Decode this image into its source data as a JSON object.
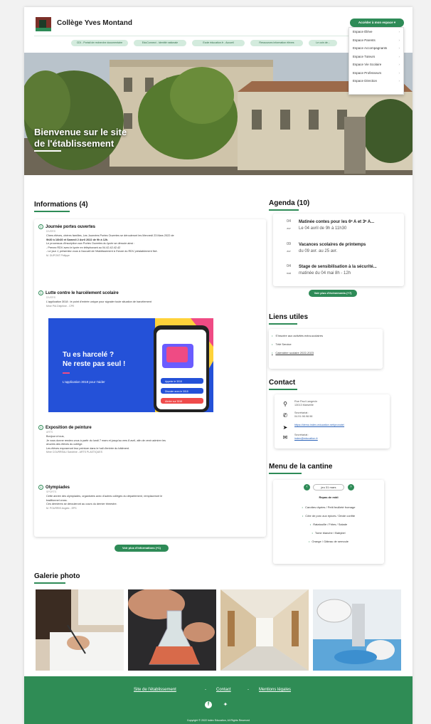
{
  "header": {
    "school_name": "Collège Yves Montand",
    "access_button": "Accéder à mon espace ▾",
    "dropdown": [
      "Espace Élève",
      "Espace Parents",
      "Espace Accompagnants",
      "Espace Tuteurs",
      "Espace Vie Scolaire",
      "Espace Professeurs",
      "Espace Direction"
    ],
    "quick_links": [
      "CDI - Portail de recherche documentaire",
      "EduConnect - Identité nationale",
      "Ecole éducation.fr - Accueil",
      "Ressources information élèves",
      "Le coin de..."
    ]
  },
  "hero": {
    "title_line1": "Bienvenue sur le site",
    "title_line2": "de l'établissement"
  },
  "info": {
    "heading": "Informations (4)",
    "button": "Voir plus d'informations (+1)",
    "items": [
      {
        "title": "Journée portes ouvertes",
        "category": "DIVERS",
        "lines": [
          "Chers élèves, chères familles, Les Journées Portes Ouvertes se dérouleront les Mercredi 23 Mars 2022 de",
          "9h30 à 16h30 et Samedi 2 Avril 2022 de 9h à 12h.",
          "Le processus d'inscription aux Portes Ouvertes du lycée se déroule ainsi :",
          "- Prenez RDV avec le lycée en téléphonant au 04.42.42.42.42",
          "- Le jour J, présentez vous à l'accueil de l'établissement à l'heure du RDV préalablement fixé."
        ],
        "signature": "M. DUPONT Philippe"
      },
      {
        "title": "Lutte contre le harcèlement scolaire",
        "category": "DIVERS",
        "lines": [
          "L'application 3018 : le point d'entrée unique pour signaler toute situation de harcèlement"
        ],
        "signature": "Mme PIA Delphine - CPE",
        "image": {
          "headline1": "Tu es harcelé ?",
          "headline2": "Ne reste pas seul !",
          "caption": "L'application 3018 pour t'aider",
          "phone_btn1": "Appeler le 3018",
          "phone_btn2": "Discuter avec le 3018",
          "phone_btn3": "Alerter sur 3018"
        }
      },
      {
        "title": "Exposition de peinture",
        "category": "ARTS",
        "lines": [
          "Bonjour à tous,",
          "Je vous donne rendez-vous à partir du lundi 7 mars et jusqu'au vers 8 avril, afin de venir admirer les",
          "œuvres des élèves du collège.",
          "Les élèves exposeront leur peinture dans le hall d'entrée du bâtiment."
        ],
        "signature": "Mme COURREAU Sandrine - ARTS PLASTIQUES"
      },
      {
        "title": "Olympiades",
        "category": "SPORTS",
        "lines": [
          "Cette année des olympiades, organisées avec d'autres collèges du département, remplaceront le",
          "traditionnel cross.",
          "Ces dernières se dérouleront au cours du dernier trimestre."
        ],
        "signature": "M. POURRIS Angelo - EPS"
      }
    ]
  },
  "agenda": {
    "heading": "Agenda (10)",
    "button": "Voir plus d'événements (+7)",
    "events": [
      {
        "day": "04",
        "month": "avr",
        "title": "Matinée contes pour les 6ᵉ A et 3ᵉ A...",
        "detail": "Le 04 avril de 9h à 11h30"
      },
      {
        "day": "09",
        "month": "avr",
        "title": "Vacances scolaires de printemps",
        "detail": "du 09 avr. au 25 avr."
      },
      {
        "day": "04",
        "month": "mai",
        "title": "Stage de sensibilisation à la sécurité...",
        "detail": "matinée du 04 mai 8h - 12h"
      }
    ]
  },
  "liens": {
    "heading": "Liens utiles",
    "items": [
      "S'inscrire aux activités extra-scolaires",
      "Télé Service",
      "Calendrier scolaire 2022-2023"
    ]
  },
  "contact": {
    "heading": "Contact",
    "address1": "Rue Paul Langevin",
    "address2": "13013 Marseille",
    "phone_label": "Secrétariat :",
    "phone": "04.91.98.98.98",
    "website": "https://demo.index-education.net/pronote/",
    "email_label": "Secrétariat :",
    "email": "index@education.fr"
  },
  "cantine": {
    "heading": "Menu de la cantine",
    "date": "jeu 31 mars",
    "meal": "Repas de midi",
    "items": [
      "Carottes râpées / Petit feuilleté fromage",
      "Côte de porc aux épices / Dinde confite",
      "Ratatouille / Frites / Salade",
      "Tome blanche / Babybel",
      "Orange / Gâteau de semoule"
    ]
  },
  "galerie": {
    "heading": "Galerie photo"
  },
  "footer": {
    "links": [
      "Site de l'établissement",
      "Contact",
      "Mentions légales"
    ],
    "separator": "-",
    "copyright": "Copyright © 2022 Index Education, All Rights Reserved"
  },
  "colors": {
    "accent": "#2e8b57"
  }
}
